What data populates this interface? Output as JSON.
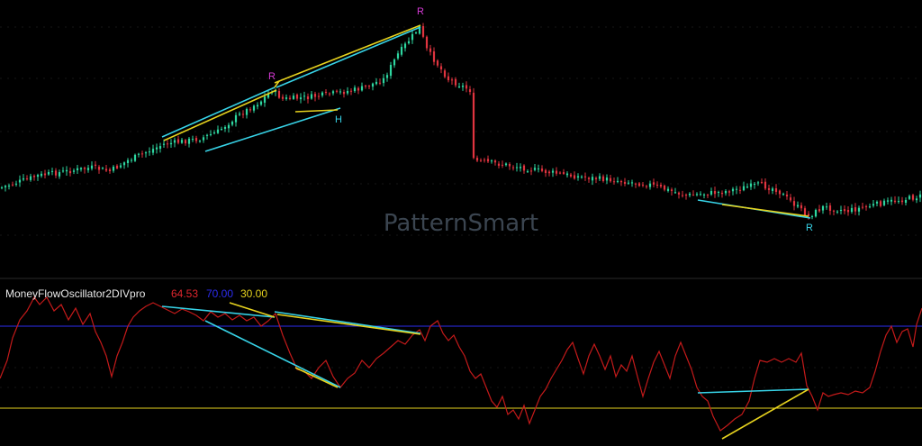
{
  "watermark": "PatternSmart",
  "indicator": {
    "name": "MoneyFlowOscillator2DIVpro",
    "value": "64.53",
    "upper": "70.00",
    "lower": "30.00",
    "value_color": "#e0262e",
    "upper_color": "#2c2cf0",
    "lower_color": "#e6d21e",
    "upper_level": 70,
    "lower_level": 30
  },
  "colors": {
    "background": "#000000",
    "bull": "#2ed6a0",
    "bear": "#e0343f",
    "divergence_cyan": "#37d2e6",
    "divergence_yellow": "#e6d21e",
    "marker_magenta": "#d63ad6",
    "marker_cyan": "#37d2e6",
    "oscillator_line": "#c41a1a",
    "upper_line": "#2c2cf0",
    "lower_line": "#e6d21e"
  },
  "chart_data": [
    {
      "type": "candlestick",
      "title": "",
      "markers": [
        {
          "text": "R",
          "color": "magenta",
          "bar": 75
        },
        {
          "text": "R",
          "color": "magenta",
          "bar": 116
        },
        {
          "text": "H",
          "color": "cyan",
          "bar": 93
        },
        {
          "text": "R",
          "color": "cyan",
          "bar": 224
        }
      ],
      "grid": false
    },
    {
      "type": "line",
      "title": "MoneyFlowOscillator2DIVpro",
      "levels": [
        70,
        30
      ],
      "last_value": 64.53,
      "grid": false
    }
  ]
}
